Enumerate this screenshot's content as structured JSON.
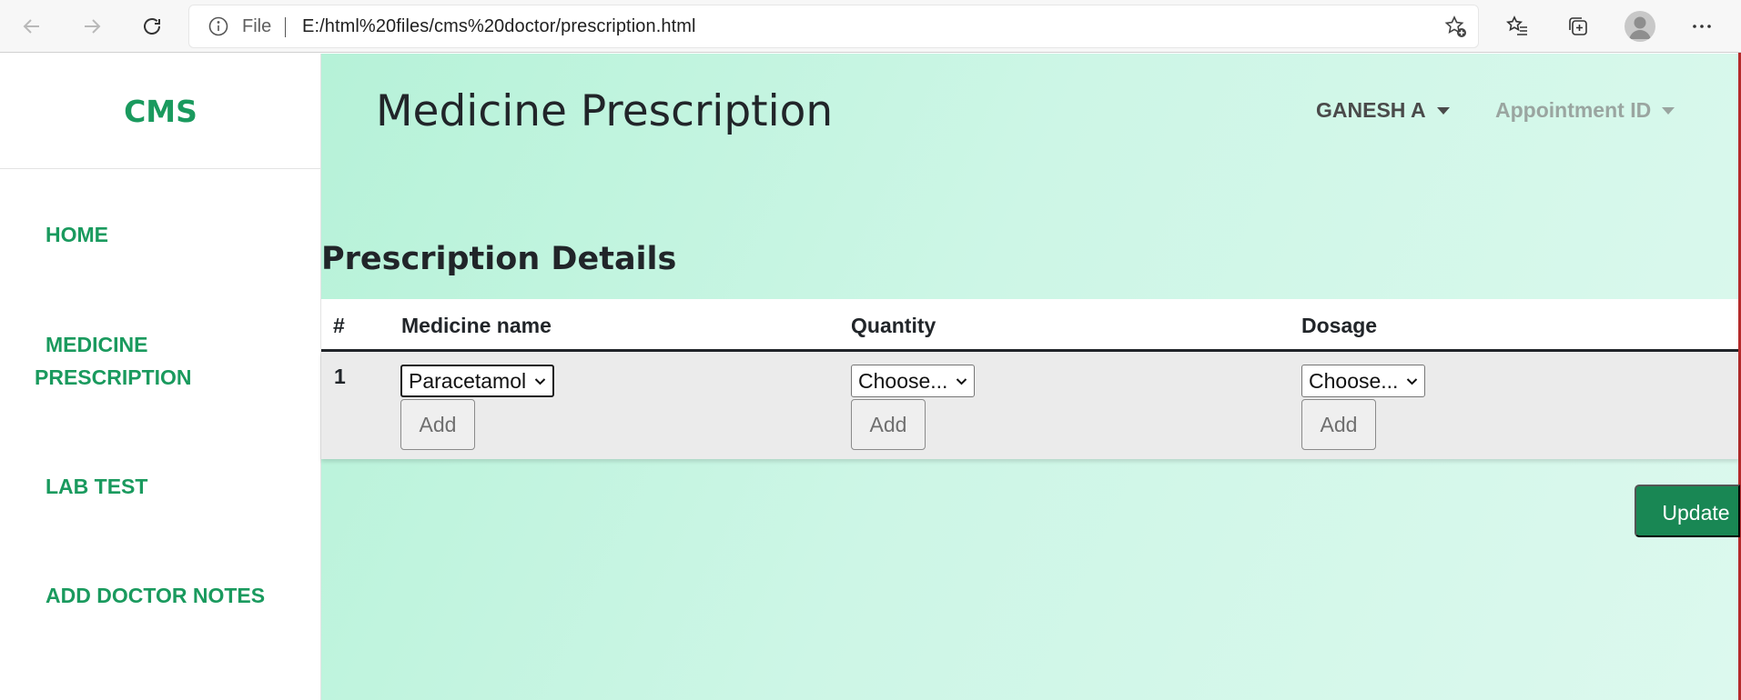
{
  "browser": {
    "scheme_label": "File",
    "url": "E:/html%20files/cms%20doctor/prescription.html"
  },
  "sidebar": {
    "brand": "CMS",
    "items": [
      {
        "label": "HOME"
      },
      {
        "label": "MEDICINE"
      },
      {
        "label": "PRESCRIPTION"
      },
      {
        "label": "LAB TEST"
      },
      {
        "label": "ADD DOCTOR NOTES"
      }
    ]
  },
  "header": {
    "title": "Medicine Prescription",
    "user_dropdown": "GANESH A",
    "appointment_dropdown": "Appointment ID"
  },
  "section": {
    "title": "Prescription Details"
  },
  "table": {
    "headers": [
      "#",
      "Medicine name",
      "Quantity",
      "Dosage"
    ],
    "rows": [
      {
        "number": "1",
        "medicine": "Paracetamol",
        "quantity": "Choose...",
        "dosage": "Choose...",
        "add_label": "Add"
      }
    ]
  },
  "actions": {
    "update_label": "Update"
  },
  "colors": {
    "brand_green": "#1a9a5e",
    "update_button": "#198754",
    "background_gradient_start": "#b6f2d8",
    "background_gradient_end": "#dcf9ee"
  },
  "icons": [
    "back-arrow-icon",
    "forward-arrow-icon",
    "refresh-icon",
    "info-icon",
    "add-favorite-icon",
    "favorites-icon",
    "collections-icon",
    "profile-icon",
    "more-icon",
    "chevron-down-icon",
    "caret-down-icon"
  ]
}
